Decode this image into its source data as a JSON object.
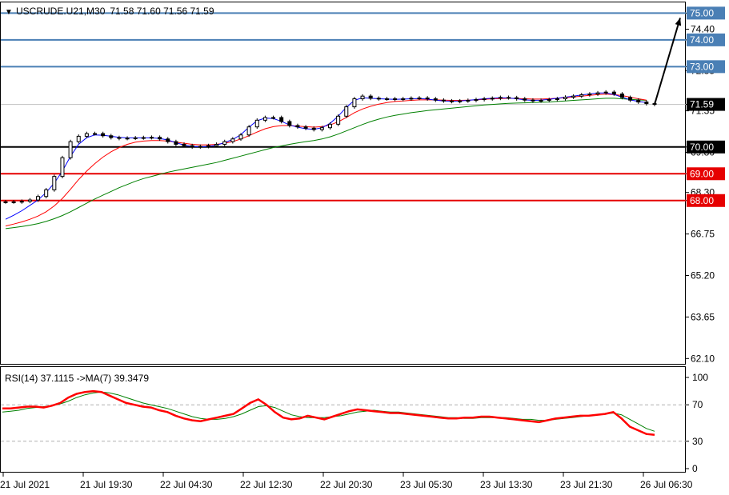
{
  "header": {
    "symbol": "USCRUDE.U21,M30",
    "ohlc": "71.58 71.60 71.56 71.59"
  },
  "colors": {
    "price_line_blue": "#4a7fb5",
    "price_line_red": "#e60000",
    "price_line_black": "#000000",
    "ma_fast": "#0000ff",
    "ma_mid": "#ff0000",
    "ma_slow": "#008000",
    "rsi_line": "#ff0000",
    "rsi_ma": "#008000",
    "arrow": "#000000"
  },
  "chart_data": [
    {
      "type": "candlestick",
      "title": "USCRUDE.U21,M30",
      "ylim": [
        61.9,
        75.4
      ],
      "y_ticks": [
        "75.00",
        "74.40",
        "74.00",
        "73.00",
        "72.85",
        "71.59",
        "71.35",
        "70.00",
        "69.80",
        "69.00",
        "68.30",
        "68.00",
        "66.75",
        "65.20",
        "63.65",
        "62.10"
      ],
      "x_ticks": [
        "21 Jul 2021",
        "21 Jul 19:30",
        "22 Jul 04:30",
        "22 Jul 12:30",
        "22 Jul 20:30",
        "23 Jul 05:30",
        "23 Jul 13:30",
        "23 Jul 21:30",
        "26 Jul 06:30"
      ],
      "current_price": 71.59,
      "levels": [
        {
          "value": 75.0,
          "label": "75.00",
          "color": "blue"
        },
        {
          "value": 74.0,
          "label": "74.00",
          "color": "blue"
        },
        {
          "value": 73.0,
          "label": "73.00",
          "color": "blue"
        },
        {
          "value": 70.0,
          "label": "70.00",
          "color": "black"
        },
        {
          "value": 69.0,
          "label": "69.00",
          "color": "red"
        },
        {
          "value": 68.0,
          "label": "68.00",
          "color": "red"
        }
      ],
      "series": [
        {
          "key": "close",
          "values": [
            67.95,
            67.95,
            67.97,
            68.02,
            68.15,
            68.4,
            68.9,
            69.6,
            70.2,
            70.4,
            70.5,
            70.5,
            70.42,
            70.35,
            70.32,
            70.33,
            70.34,
            70.35,
            70.36,
            70.3,
            70.2,
            70.1,
            70.05,
            70.0,
            70.02,
            70.05,
            70.1,
            70.2,
            70.3,
            70.45,
            70.75,
            71.0,
            71.1,
            71.1,
            70.95,
            70.8,
            70.75,
            70.7,
            70.65,
            70.72,
            70.85,
            71.15,
            71.5,
            71.8,
            71.9,
            71.82,
            71.8,
            71.8,
            71.78,
            71.8,
            71.82,
            71.83,
            71.8,
            71.75,
            71.72,
            71.7,
            71.72,
            71.74,
            71.77,
            71.8,
            71.82,
            71.85,
            71.84,
            71.8,
            71.75,
            71.72,
            71.74,
            71.77,
            71.8,
            71.86,
            71.9,
            71.95,
            71.98,
            72.02,
            72.05,
            71.98,
            71.85,
            71.75,
            71.68,
            71.62,
            71.59
          ]
        },
        {
          "key": "ma_fast",
          "values": [
            67.3,
            67.45,
            67.62,
            67.82,
            68.02,
            68.3,
            68.65,
            69.1,
            69.65,
            70.1,
            70.35,
            70.45,
            70.44,
            70.4,
            70.36,
            70.34,
            70.34,
            70.34,
            70.34,
            70.32,
            70.26,
            70.16,
            70.07,
            70.02,
            70.0,
            70.02,
            70.07,
            70.16,
            70.28,
            70.46,
            70.74,
            70.98,
            71.08,
            71.06,
            70.96,
            70.82,
            70.74,
            70.68,
            70.66,
            70.72,
            70.88,
            71.15,
            71.48,
            71.74,
            71.84,
            71.82,
            71.8,
            71.79,
            71.78,
            71.79,
            71.8,
            71.81,
            71.79,
            71.75,
            71.72,
            71.71,
            71.72,
            71.74,
            71.77,
            71.8,
            71.82,
            71.84,
            71.83,
            71.8,
            71.76,
            71.74,
            71.75,
            71.78,
            71.82,
            71.86,
            71.9,
            71.94,
            71.98,
            72.02,
            72.02,
            71.96,
            71.86,
            71.76,
            71.7,
            71.66
          ]
        },
        {
          "key": "ma_mid",
          "values": [
            67.05,
            67.12,
            67.2,
            67.3,
            67.42,
            67.58,
            67.8,
            68.08,
            68.42,
            68.78,
            69.1,
            69.38,
            69.62,
            69.82,
            69.98,
            70.1,
            70.18,
            70.22,
            70.24,
            70.24,
            70.22,
            70.18,
            70.14,
            70.1,
            70.08,
            70.08,
            70.1,
            70.14,
            70.2,
            70.3,
            70.42,
            70.56,
            70.68,
            70.76,
            70.8,
            70.8,
            70.78,
            70.76,
            70.74,
            70.76,
            70.82,
            70.94,
            71.1,
            71.28,
            71.42,
            71.52,
            71.6,
            71.66,
            71.7,
            71.72,
            71.74,
            71.76,
            71.76,
            71.76,
            71.75,
            71.74,
            71.74,
            71.75,
            71.76,
            71.78,
            71.8,
            71.81,
            71.82,
            71.81,
            71.8,
            71.79,
            71.79,
            71.8,
            71.82,
            71.84,
            71.87,
            71.9,
            71.93,
            71.96,
            71.97,
            71.96,
            71.92,
            71.86,
            71.8,
            71.75
          ]
        },
        {
          "key": "ma_slow",
          "values": [
            66.95,
            66.99,
            67.03,
            67.08,
            67.14,
            67.22,
            67.32,
            67.44,
            67.58,
            67.74,
            67.9,
            68.06,
            68.2,
            68.34,
            68.48,
            68.6,
            68.72,
            68.82,
            68.9,
            68.98,
            69.06,
            69.12,
            69.18,
            69.24,
            69.3,
            69.36,
            69.42,
            69.5,
            69.58,
            69.66,
            69.74,
            69.82,
            69.9,
            69.98,
            70.04,
            70.1,
            70.15,
            70.2,
            70.24,
            70.3,
            70.38,
            70.48,
            70.6,
            70.72,
            70.84,
            70.95,
            71.04,
            71.12,
            71.18,
            71.23,
            71.28,
            71.32,
            71.36,
            71.39,
            71.42,
            71.45,
            71.48,
            71.51,
            71.54,
            71.57,
            71.59,
            71.61,
            71.63,
            71.64,
            71.65,
            71.66,
            71.67,
            71.68,
            71.7,
            71.72,
            71.74,
            71.76,
            71.78,
            71.8,
            71.82,
            71.82,
            71.8,
            71.78,
            71.76,
            71.74
          ]
        }
      ],
      "projection": {
        "from": 71.59,
        "to": 75.0
      }
    },
    {
      "type": "line",
      "title": "RSI(14) 37.1115 ->MA(7) 39.3479",
      "ylim": [
        0,
        100
      ],
      "y_ticks": [
        "100",
        "70",
        "30",
        "0"
      ],
      "series": [
        {
          "key": "rsi",
          "values": [
            66,
            66,
            67,
            68,
            68,
            67,
            69,
            72,
            78,
            82,
            84,
            85,
            84,
            80,
            76,
            72,
            70,
            68,
            67,
            64,
            62,
            58,
            55,
            53,
            52,
            54,
            56,
            58,
            60,
            66,
            72,
            76,
            70,
            62,
            56,
            54,
            55,
            58,
            56,
            54,
            57,
            60,
            63,
            65,
            64,
            63,
            62,
            61,
            61,
            60,
            59,
            58,
            57,
            56,
            55,
            55,
            56,
            56,
            57,
            57,
            56,
            55,
            54,
            53,
            52,
            51,
            53,
            55,
            56,
            57,
            58,
            58,
            59,
            60,
            62,
            55,
            46,
            42,
            38,
            37
          ]
        },
        {
          "key": "rsi_ma",
          "values": [
            62,
            63,
            64,
            66,
            67,
            68,
            69,
            71,
            74,
            78,
            81,
            83,
            84,
            83,
            81,
            78,
            75,
            72,
            70,
            68,
            66,
            63,
            60,
            57,
            55,
            54,
            54,
            55,
            57,
            60,
            64,
            68,
            69,
            67,
            63,
            59,
            57,
            56,
            56,
            56,
            57,
            58,
            60,
            62,
            63,
            64,
            63,
            62,
            62,
            61,
            60,
            59,
            58,
            57,
            56,
            56,
            55,
            55,
            56,
            56,
            56,
            56,
            55,
            54,
            54,
            53,
            53,
            54,
            55,
            56,
            57,
            58,
            59,
            60,
            61,
            59,
            54,
            49,
            44,
            41
          ]
        }
      ]
    }
  ]
}
